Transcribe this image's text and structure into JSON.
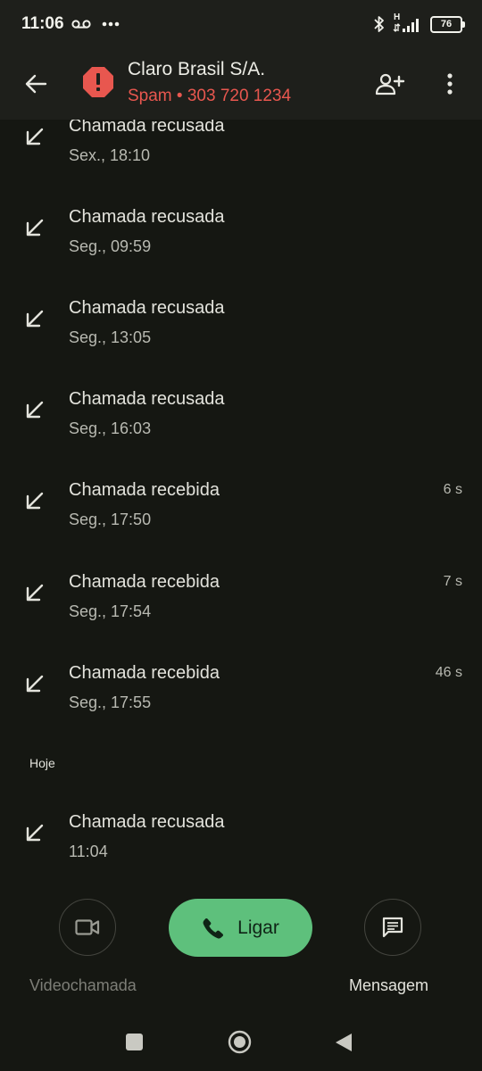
{
  "status_bar": {
    "time": "11:06",
    "network_type": "H",
    "battery": "76"
  },
  "header": {
    "contact_name": "Claro Brasil S/A.",
    "subtitle": "Spam • 303 720 1234"
  },
  "calls": [
    {
      "title": "Chamada recusada",
      "time": "Sex., 18:10",
      "duration": ""
    },
    {
      "title": "Chamada recusada",
      "time": "Seg., 09:59",
      "duration": ""
    },
    {
      "title": "Chamada recusada",
      "time": "Seg., 13:05",
      "duration": ""
    },
    {
      "title": "Chamada recusada",
      "time": "Seg., 16:03",
      "duration": ""
    },
    {
      "title": "Chamada recebida",
      "time": "Seg., 17:50",
      "duration": "6 s"
    },
    {
      "title": "Chamada recebida",
      "time": "Seg., 17:54",
      "duration": "7 s"
    },
    {
      "title": "Chamada recebida",
      "time": "Seg., 17:55",
      "duration": "46 s"
    }
  ],
  "today_section": {
    "label": "Hoje",
    "calls": [
      {
        "title": "Chamada recusada",
        "time": "11:04",
        "duration": ""
      }
    ]
  },
  "actions": {
    "video_label": "Videochamada",
    "call_label": "Ligar",
    "message_label": "Mensagem"
  },
  "colors": {
    "background": "#151712",
    "header": "#1e1f1b",
    "spam_red": "#e8574f",
    "call_green": "#5ec07c"
  },
  "icons": {
    "call_direction": "incoming-arrow-icon",
    "video": "videocam-icon",
    "call": "phone-icon",
    "message": "message-icon"
  }
}
